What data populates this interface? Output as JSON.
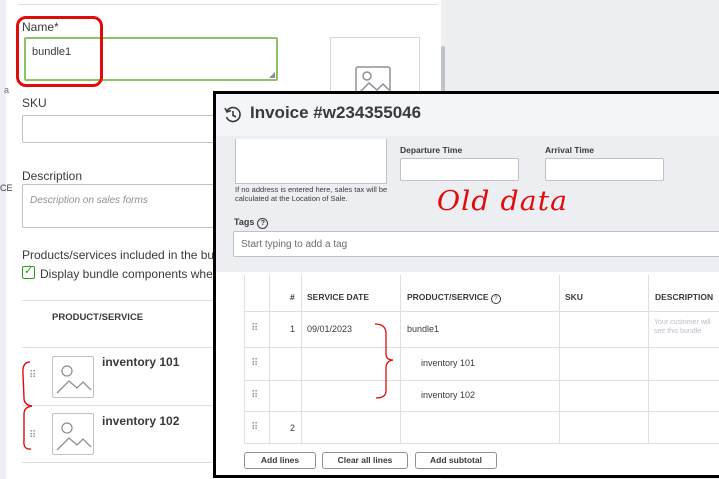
{
  "product_form": {
    "name_label": "Name*",
    "name_value": "bundle1",
    "sku_label": "SKU",
    "sku_value": "",
    "description_label": "Description",
    "description_placeholder": "Description on sales forms",
    "bundle_section_label": "Products/services included in the bun",
    "display_components_label": "Display bundle components when",
    "display_components_checked": true,
    "table_header": "PRODUCT/SERVICE",
    "components": [
      {
        "name": "inventory 101"
      },
      {
        "name": "inventory 102"
      }
    ],
    "side_stub_a": "a",
    "side_stub_ce": "CE"
  },
  "invoice": {
    "title": "Invoice #w234355046",
    "address_note": "If no address is entered here, sales tax will be calculated at the Location of Sale.",
    "departure_label": "Departure Time",
    "arrival_label": "Arrival Time",
    "tags_label": "Tags",
    "tags_placeholder": "Start typing to add a tag",
    "columns": {
      "num": "#",
      "service_date": "SERVICE DATE",
      "product_service": "PRODUCT/SERVICE",
      "sku": "SKU",
      "description": "DESCRIPTION"
    },
    "rows": [
      {
        "num": "1",
        "service_date": "09/01/2023",
        "product": "bundle1",
        "description": "Your customer will see this bundle"
      },
      {
        "num": "",
        "service_date": "",
        "product": "inventory 101",
        "description": ""
      },
      {
        "num": "",
        "service_date": "",
        "product": "inventory 102",
        "description": ""
      },
      {
        "num": "2",
        "service_date": "",
        "product": "",
        "description": ""
      }
    ],
    "buttons": {
      "add_lines": "Add lines",
      "clear_all_lines": "Clear all lines",
      "add_subtotal": "Add subtotal"
    }
  },
  "annotation": {
    "text": "Old data",
    "color": "#e00c0c"
  },
  "colors": {
    "accent_green": "#2ca01c",
    "highlight_red": "#e00c0c",
    "panel_gray": "#eceef1"
  }
}
